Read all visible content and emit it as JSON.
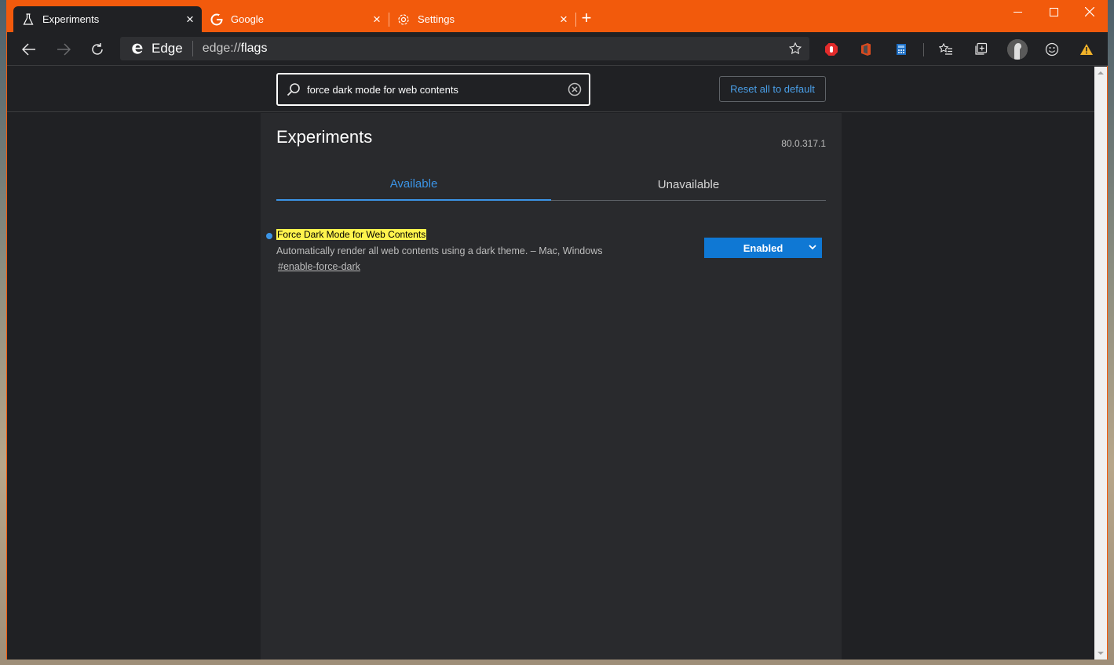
{
  "tabs": [
    {
      "title": "Experiments",
      "icon": "flask-icon",
      "active": true
    },
    {
      "title": "Google",
      "icon": "google-icon",
      "active": false
    },
    {
      "title": "Settings",
      "icon": "gear-icon",
      "active": false
    }
  ],
  "colors": {
    "accent": "#f25a0c",
    "link": "#3b94e6",
    "highlight": "#fff34d",
    "select": "#0f78d4"
  },
  "toolbar": {
    "brand": "Edge",
    "url_scheme": "edge://",
    "url_host": "flags",
    "extensions": [
      "adblock-icon",
      "office-icon",
      "calculator-icon",
      "favorites-icon",
      "collections-icon",
      "profile-avatar",
      "feedback-smiley-icon",
      "warning-icon"
    ]
  },
  "search": {
    "value": "force dark mode for web contents"
  },
  "reset_label": "Reset all to default",
  "page": {
    "title": "Experiments",
    "version": "80.0.317.1",
    "tab_available": "Available",
    "tab_unavailable": "Unavailable"
  },
  "flag": {
    "name": "Force Dark Mode for Web Contents",
    "description": "Automatically render all web contents using a dark theme. – Mac, Windows",
    "link": "#enable-force-dark",
    "state": "Enabled"
  }
}
